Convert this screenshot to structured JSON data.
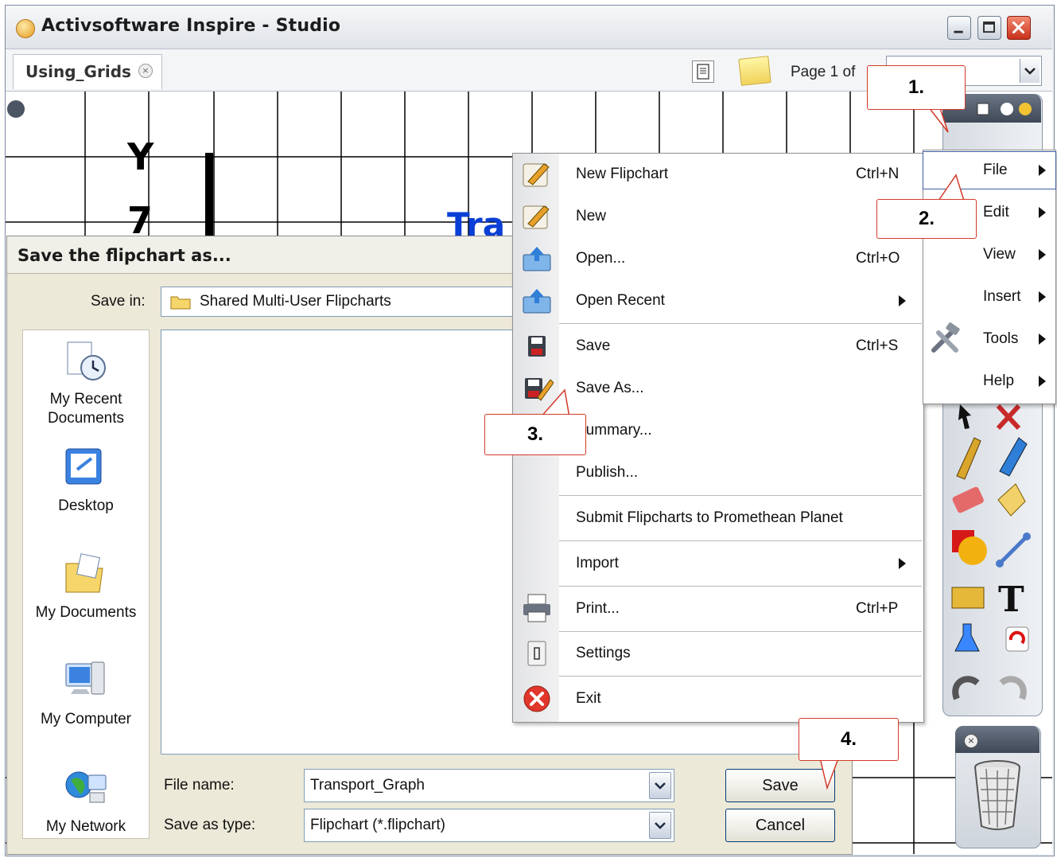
{
  "window": {
    "title": "Activsoftware Inspire - Studio",
    "buttons": [
      "minimize",
      "maximize",
      "close"
    ]
  },
  "tabbar": {
    "tab_label": "Using_Grids",
    "page_label": "Page 1 of"
  },
  "canvas": {
    "axis_y": "Y",
    "axis_value": "7",
    "partial_text": "Tra"
  },
  "dialog": {
    "title": "Save the flipchart as...",
    "save_in_label": "Save in:",
    "save_in_value": "Shared Multi-User Flipcharts",
    "places": [
      "My Recent Documents",
      "Desktop",
      "My Documents",
      "My Computer",
      "My Network"
    ],
    "file_name_label": "File name:",
    "file_name_value": "Transport_Graph",
    "save_type_label": "Save as type:",
    "save_type_value": "Flipchart (*.flipchart)",
    "save_button": "Save",
    "cancel_button": "Cancel"
  },
  "file_menu": {
    "items": [
      {
        "label": "New Flipchart",
        "shortcut": "Ctrl+N"
      },
      {
        "label": "New",
        "shortcut": ""
      },
      {
        "label": "Open...",
        "shortcut": "Ctrl+O"
      },
      {
        "label": "Open Recent",
        "shortcut": ""
      },
      {
        "label": "Save",
        "shortcut": "Ctrl+S"
      },
      {
        "label": "Save As...",
        "shortcut": ""
      },
      {
        "label": "Summary...",
        "shortcut": ""
      },
      {
        "label": "Publish...",
        "shortcut": ""
      },
      {
        "label": "Submit Flipcharts to Promethean Planet",
        "shortcut": ""
      },
      {
        "label": "Import",
        "shortcut": ""
      },
      {
        "label": "Print...",
        "shortcut": "Ctrl+P"
      },
      {
        "label": "Settings",
        "shortcut": ""
      },
      {
        "label": "Exit",
        "shortcut": ""
      }
    ]
  },
  "main_menu": {
    "items": [
      "File",
      "Edit",
      "View",
      "Insert",
      "Tools",
      "Help"
    ]
  },
  "callouts": [
    "1.",
    "2.",
    "3.",
    "4."
  ],
  "colors": {
    "canvas_text": "#0a3fd6",
    "callout_border": "#d23a2a",
    "highlight_border": "#3f5ea8"
  }
}
